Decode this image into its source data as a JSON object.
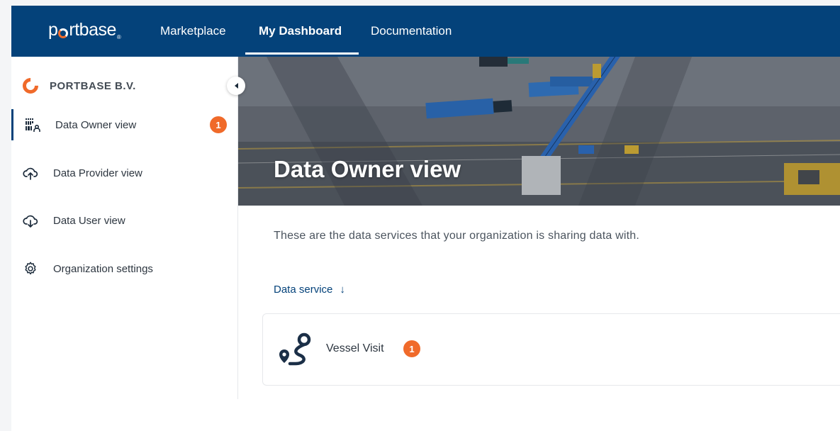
{
  "topnav": {
    "logo": "portbase",
    "items": [
      {
        "label": "Marketplace"
      },
      {
        "label": "My Dashboard"
      },
      {
        "label": "Documentation"
      }
    ]
  },
  "sidebar": {
    "org_name": "PORTBASE B.V.",
    "items": [
      {
        "label": "Data Owner view",
        "icon": "data-owner-icon",
        "badge": "1"
      },
      {
        "label": "Data Provider view",
        "icon": "cloud-upload-icon"
      },
      {
        "label": "Data User view",
        "icon": "cloud-download-icon"
      },
      {
        "label": "Organization settings",
        "icon": "gear-icon"
      }
    ]
  },
  "hero": {
    "title": "Data Owner view"
  },
  "main": {
    "intro": "These are the data services that your organization is sharing data with.",
    "sort_label": "Data service",
    "sort_arrow": "↓",
    "services": [
      {
        "name": "Vessel Visit",
        "badge": "1",
        "icon": "route-pin-icon"
      }
    ]
  },
  "colors": {
    "nav_bg": "#04427a",
    "accent": "#f06a2a",
    "text": "#2d3640"
  }
}
